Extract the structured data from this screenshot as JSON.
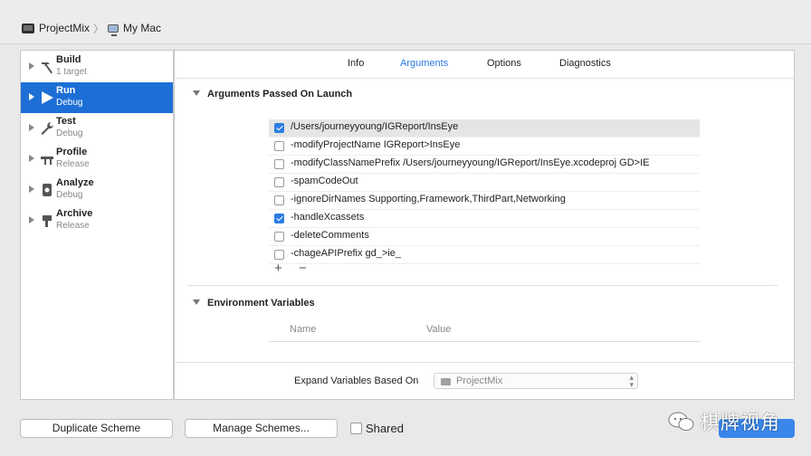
{
  "breadcrumb": {
    "scheme": "ProjectMix",
    "destination": "My Mac"
  },
  "sidebar": {
    "items": [
      {
        "label": "Build",
        "sub": "1 target",
        "icon": "hammer-icon",
        "selected": false
      },
      {
        "label": "Run",
        "sub": "Debug",
        "icon": "play-icon",
        "selected": true
      },
      {
        "label": "Test",
        "sub": "Debug",
        "icon": "wrench-icon",
        "selected": false
      },
      {
        "label": "Profile",
        "sub": "Release",
        "icon": "instruments-icon",
        "selected": false
      },
      {
        "label": "Analyze",
        "sub": "Debug",
        "icon": "analyze-icon",
        "selected": false
      },
      {
        "label": "Archive",
        "sub": "Release",
        "icon": "archive-icon",
        "selected": false
      }
    ]
  },
  "tabs": {
    "info": "Info",
    "arguments": "Arguments",
    "options": "Options",
    "diagnostics": "Diagnostics",
    "active": "Arguments"
  },
  "arguments_section": {
    "title": "Arguments Passed On Launch",
    "rows": [
      {
        "text": "/Users/journeyyoung/IGReport/InsEye",
        "checked": true
      },
      {
        "text": "-modifyProjectName IGReport>InsEye",
        "checked": false
      },
      {
        "text": "-modifyClassNamePrefix /Users/journeyyoung/IGReport/InsEye.xcodeproj GD>IE",
        "checked": false
      },
      {
        "text": "-spamCodeOut",
        "checked": false
      },
      {
        "text": "-ignoreDirNames Supporting,Framework,ThirdPart,Networking",
        "checked": false
      },
      {
        "text": "-handleXcassets",
        "checked": true
      },
      {
        "text": "-deleteComments",
        "checked": false
      },
      {
        "text": "-chageAPIPrefix gd_>ie_",
        "checked": false
      }
    ],
    "add_symbol": "+",
    "remove_symbol": "−"
  },
  "environment_section": {
    "title": "Environment Variables",
    "col_name": "Name",
    "col_value": "Value"
  },
  "expand_variables": {
    "label": "Expand Variables Based On",
    "value": "ProjectMix"
  },
  "bottom": {
    "duplicate": "Duplicate Scheme",
    "manage": "Manage Schemes...",
    "shared": "Shared",
    "close": "Close"
  },
  "watermark": "棋牌视角",
  "colors": {
    "selection": "#1d6fd6",
    "accent": "#2a7ae2",
    "checkbox_on": "#2c7ce4"
  }
}
